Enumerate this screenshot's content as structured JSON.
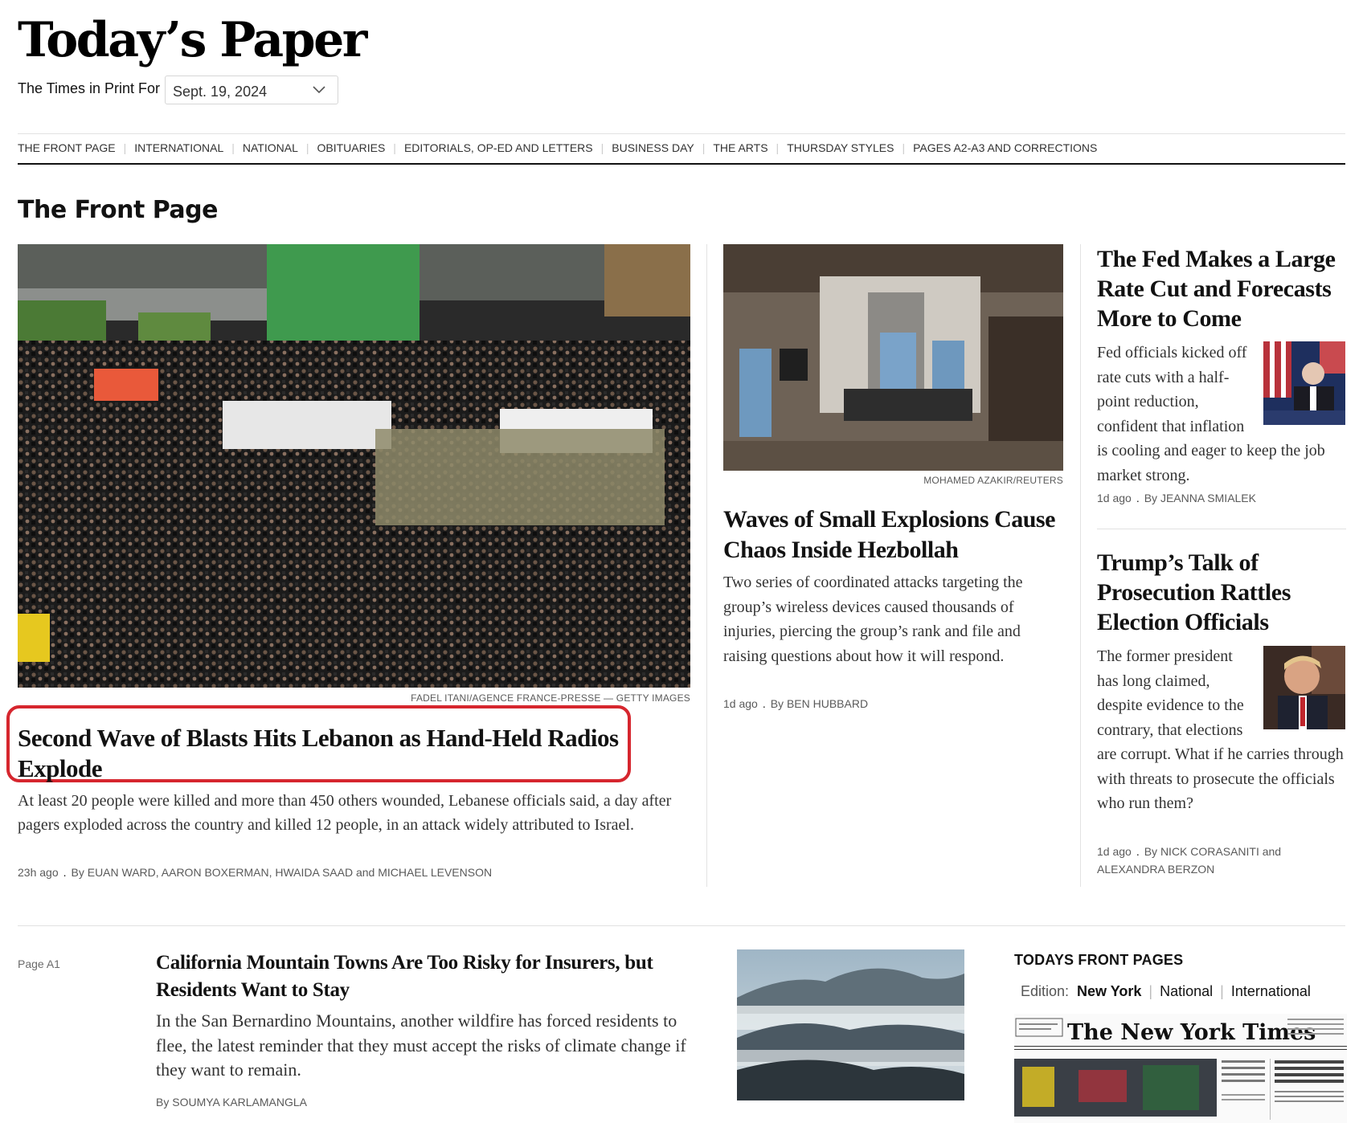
{
  "masthead": {
    "title": "Today’s Paper",
    "print_for_label": "The Times in Print For",
    "selected_date": "Sept. 19, 2024"
  },
  "sections_nav": [
    "THE FRONT PAGE",
    "INTERNATIONAL",
    "NATIONAL",
    "OBITUARIES",
    "EDITORIALS, OP-ED AND LETTERS",
    "BUSINESS DAY",
    "THE ARTS",
    "THURSDAY STYLES",
    "PAGES A2-A3 AND CORRECTIONS"
  ],
  "section_heading": "The Front Page",
  "lead": {
    "photo_credit": "FADEL ITANI/AGENCE FRANCE-PRESSE — GETTY IMAGES",
    "headline": "Second Wave of Blasts Hits Lebanon as Hand-Held Radios Explode",
    "summary": "At least 20 people were killed and more than 450 others wounded, Lebanese officials said, a day after pagers exploded across the country and killed 12 people, in an attack widely attributed to Israel.",
    "time": "23h ago",
    "byline": "By EUAN WARD, AARON BOXERMAN, HWAIDA SAAD and MICHAEL LEVENSON",
    "highlight_color": "#d6262e"
  },
  "middle": {
    "photo_credit": "MOHAMED AZAKIR/REUTERS",
    "headline": "Waves of Small Explosions Cause Chaos Inside Hezbollah",
    "summary": "Two series of coordinated attacks targeting the group’s wireless devices caused thousands of injuries, piercing the group’s rank and file and raising questions about how it will respond.",
    "time": "1d ago",
    "byline": "By BEN HUBBARD"
  },
  "fed": {
    "headline": "The Fed Makes a Large Rate Cut and Forecasts More to Come",
    "summary": "Fed officials kicked off rate cuts with a half-point reduction, confident that inflation is cooling and eager to keep the job market strong.",
    "time": "1d ago",
    "byline": "By JEANNA SMIALEK"
  },
  "trump": {
    "headline": "Trump’s Talk of Prosecution Rattles Election Officials",
    "summary": "The former president has long claimed, despite evidence to the contrary, that elections are corrupt. What if he carries through with threats to prosecute the officials who run them?",
    "time": "1d ago",
    "byline": "By NICK CORASANITI and ALEXANDRA BERZON"
  },
  "california": {
    "page_label": "Page A1",
    "headline": "California Mountain Towns Are Too Risky for Insurers, but Residents Want to Stay",
    "summary": "In the San Bernardino Mountains, another wildfire has forced residents to flee, the latest reminder that they must accept the risks of climate change if they want to remain.",
    "byline": "By SOUMYA KARLAMANGLA"
  },
  "front_pages": {
    "heading": "TODAYS FRONT PAGES",
    "edition_label": "Edition:",
    "editions": [
      "New York",
      "National",
      "International"
    ],
    "active_edition": "New York",
    "nameplate": "The New York Times"
  }
}
